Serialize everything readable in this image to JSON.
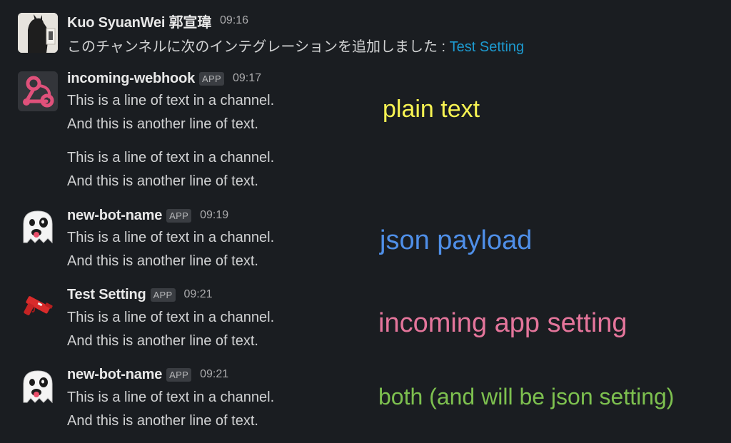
{
  "messages": [
    {
      "user": "Kuo SyuanWei 郭宣瑋",
      "time": "09:16",
      "avatar": "user-photo-avatar",
      "text_prefix": "このチャンネルに次のインテグレーションを追加しました : ",
      "text_link": "Test Setting"
    },
    {
      "user": "incoming-webhook",
      "badge": "APP",
      "time": "09:17",
      "avatar": "webhook-icon",
      "lines": [
        "This is a line of text in a channel.",
        "And this is another line of text.",
        "This is a line of text in a channel.",
        "And this is another line of text."
      ]
    },
    {
      "user": "new-bot-name",
      "badge": "APP",
      "time": "09:19",
      "avatar": "ghost-emoji-icon",
      "lines": [
        "This is a line of text in a channel.",
        "And this is another line of text."
      ]
    },
    {
      "user": "Test Setting",
      "badge": "APP",
      "time": "09:21",
      "avatar": "water-pistol-icon",
      "lines": [
        "This is a line of text in a channel.",
        "And this is another line of text."
      ]
    },
    {
      "user": "new-bot-name",
      "badge": "APP",
      "time": "09:21",
      "avatar": "ghost-emoji-icon",
      "lines": [
        "This is a line of text in a channel.",
        "And this is another line of text."
      ]
    }
  ],
  "annotations": [
    {
      "text": "plain text",
      "color": "#f7f352"
    },
    {
      "text": "json payload",
      "color": "#4f8fe8"
    },
    {
      "text": "incoming app setting",
      "color": "#e4759b"
    },
    {
      "text": "both (and will be json setting)",
      "color": "#7dc04f"
    }
  ],
  "colors": {
    "background": "#1a1d21",
    "link": "#1d9bd1",
    "webhook_icon": "#e0517b"
  }
}
